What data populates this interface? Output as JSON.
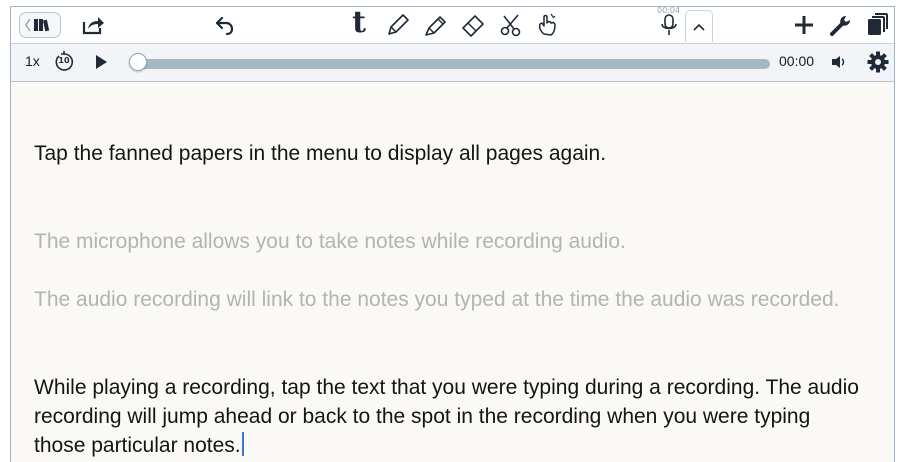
{
  "toolbar": {
    "icons": [
      "library-icon",
      "share-icon",
      "undo-icon",
      "text-tool-icon",
      "pencil-icon",
      "highlighter-icon",
      "eraser-icon",
      "scissors-icon",
      "pointer-hand-icon",
      "microphone-icon",
      "chevron-up-icon",
      "add-icon",
      "wrench-icon",
      "pages-icon"
    ],
    "text_tool_label": "t",
    "recording_time": "00:04"
  },
  "playback": {
    "speed": "1x",
    "skip_back_label": "10",
    "time": "00:00",
    "progress": 0,
    "icons": [
      "skip-back-10-icon",
      "play-icon",
      "volume-icon",
      "settings-gear-icon"
    ]
  },
  "note": {
    "paragraphs": [
      {
        "text": "Tap the fanned papers in the menu to display all pages again.",
        "faded": false
      },
      {
        "text": "The microphone allows you to take notes while recording audio.",
        "faded": true
      },
      {
        "text": "The audio recording will link to the notes you typed at the time the audio was recorded.",
        "faded": true
      },
      {
        "text": "While playing a recording, tap the text that you were typing during a recording. The audio recording will jump ahead or back to the spot in the recording when you were typing those particular notes.",
        "faded": false
      }
    ]
  },
  "colors": {
    "accent": "#3b73e0",
    "track": "#a6b7c6",
    "page": "#faf9f5",
    "faded_text": "#b3b3b3"
  }
}
